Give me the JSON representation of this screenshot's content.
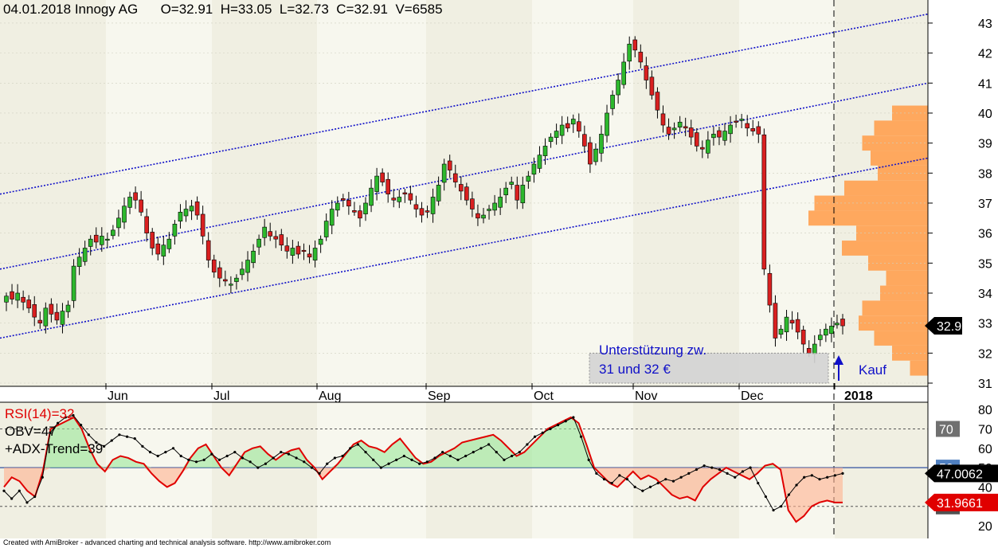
{
  "header": {
    "date": "04.01.2018",
    "name": "Innogy AG",
    "ohlcv": "O=32.91  H=33.05  L=32.73  C=32.91  V=6585"
  },
  "footer": "Created with AmiBroker - advanced charting and technical analysis software. http://www.amibroker.com",
  "colors": {
    "up": "#2db82d",
    "down": "#d92020",
    "channel": "#1010c8",
    "volume_profile": "#ffa050",
    "rsi": "#e00000",
    "obv": "#000000",
    "ref_line": "#3050a0"
  },
  "chart_data": [
    {
      "type": "candlestick",
      "title": "04.01.2018 Innogy AG",
      "ylim": [
        31,
        43
      ],
      "y_ticks": [
        31,
        32,
        33,
        34,
        35,
        36,
        37,
        38,
        39,
        40,
        41,
        42,
        43
      ],
      "x_labels": [
        "Jun",
        "Jul",
        "Aug",
        "Sep",
        "Oct",
        "Nov",
        "Dec",
        "2018"
      ],
      "last_price_label": "32.91",
      "annotations": [
        {
          "text": "Unterstützung zw.",
          "text2": "31 und 32 €"
        },
        {
          "text": "Kauf"
        }
      ],
      "close_path": [
        33.9,
        33.8,
        34.0,
        33.7,
        33.5,
        33.2,
        33.0,
        33.5,
        33.3,
        33.1,
        33.4,
        33.6,
        34.9,
        35.2,
        35.5,
        35.8,
        35.7,
        35.9,
        35.8,
        36.1,
        36.5,
        36.9,
        37.2,
        37.1,
        36.7,
        36.0,
        35.5,
        35.3,
        35.6,
        35.8,
        36.3,
        36.7,
        36.8,
        36.9,
        36.6,
        35.9,
        35.1,
        34.7,
        34.5,
        34.4,
        34.3,
        34.5,
        34.8,
        35.1,
        35.4,
        35.8,
        36.2,
        35.9,
        35.8,
        35.6,
        35.4,
        35.5,
        35.3,
        35.4,
        35.2,
        35.5,
        35.8,
        36.4,
        36.8,
        37.0,
        37.1,
        36.9,
        36.7,
        36.5,
        37.0,
        37.5,
        37.9,
        37.7,
        37.3,
        37.1,
        37.2,
        37.3,
        37.1,
        36.8,
        36.6,
        36.7,
        37.2,
        37.6,
        38.3,
        38.1,
        37.7,
        37.4,
        37.1,
        36.8,
        36.5,
        36.6,
        36.8,
        37.0,
        37.2,
        37.5,
        37.7,
        37.1,
        37.6,
        37.9,
        38.3,
        38.6,
        38.9,
        39.2,
        39.4,
        39.6,
        39.5,
        39.8,
        39.4,
        38.9,
        38.3,
        38.8,
        39.3,
        40.0,
        40.6,
        41.1,
        41.7,
        42.3,
        42.1,
        41.7,
        41.1,
        40.6,
        40.1,
        39.6,
        39.3,
        39.5,
        39.7,
        39.5,
        39.2,
        38.9,
        38.8,
        39.1,
        39.3,
        39.2,
        39.4,
        39.6,
        39.7,
        39.8,
        39.5,
        39.4,
        39.3,
        34.8,
        33.6,
        32.5,
        32.8,
        33.2,
        33.0,
        32.7,
        32.3,
        32.0,
        32.3,
        32.6,
        32.8,
        32.9,
        33.0,
        32.91
      ],
      "channel_lines": [
        {
          "start": [
            0,
            37.3
          ],
          "end": [
            1,
            43.3
          ]
        },
        {
          "start": [
            0,
            34.8
          ],
          "end": [
            1,
            41.0
          ]
        },
        {
          "start": [
            0,
            32.5
          ],
          "end": [
            1,
            38.5
          ]
        }
      ],
      "volume_profile": [
        {
          "price": 40.0,
          "v": 0.3
        },
        {
          "price": 39.5,
          "v": 0.45
        },
        {
          "price": 39.0,
          "v": 0.55
        },
        {
          "price": 38.5,
          "v": 0.48
        },
        {
          "price": 38.0,
          "v": 0.42
        },
        {
          "price": 37.5,
          "v": 0.7
        },
        {
          "price": 37.0,
          "v": 0.95
        },
        {
          "price": 36.5,
          "v": 1.0
        },
        {
          "price": 36.0,
          "v": 0.6
        },
        {
          "price": 35.5,
          "v": 0.72
        },
        {
          "price": 35.0,
          "v": 0.5
        },
        {
          "price": 34.5,
          "v": 0.35
        },
        {
          "price": 34.0,
          "v": 0.4
        },
        {
          "price": 33.5,
          "v": 0.55
        },
        {
          "price": 33.0,
          "v": 0.58
        },
        {
          "price": 32.5,
          "v": 0.45
        },
        {
          "price": 32.0,
          "v": 0.3
        },
        {
          "price": 31.5,
          "v": 0.15
        }
      ]
    },
    {
      "type": "line",
      "title": "RSI(14)=32",
      "labels": [
        "RSI(14)=32",
        "OBV=47",
        "+ADX-Trend=39"
      ],
      "ylim": [
        15,
        80
      ],
      "y_ticks": [
        20,
        30,
        40,
        50,
        60,
        70,
        80
      ],
      "levels": [
        "70",
        "50",
        "30"
      ],
      "value_labels": [
        "47.0062",
        "31.9661"
      ],
      "series": [
        {
          "name": "RSI(14)",
          "values": [
            40,
            45,
            43,
            38,
            35,
            48,
            70,
            72,
            74,
            76,
            70,
            60,
            52,
            48,
            54,
            56,
            55,
            53,
            52,
            47,
            43,
            40,
            42,
            48,
            55,
            60,
            62,
            56,
            50,
            46,
            52,
            58,
            60,
            61,
            57,
            54,
            57,
            59,
            60,
            54,
            50,
            44,
            48,
            52,
            57,
            62,
            64,
            61,
            60,
            58,
            62,
            65,
            60,
            55,
            52,
            53,
            56,
            58,
            60,
            63,
            64,
            65,
            66,
            67,
            64,
            60,
            56,
            58,
            62,
            66,
            70,
            72,
            74,
            76,
            73,
            62,
            50,
            46,
            42,
            40,
            44,
            48,
            44,
            46,
            44,
            40,
            36,
            34,
            35,
            33,
            40,
            44,
            47,
            50,
            48,
            46,
            44,
            47,
            51,
            52,
            49,
            28,
            22,
            25,
            30,
            32,
            33,
            32,
            31.97
          ]
        },
        {
          "name": "OBV",
          "values": [
            38,
            34,
            38,
            32,
            35,
            45,
            68,
            73,
            76,
            77,
            72,
            67,
            63,
            61,
            64,
            67,
            66,
            65,
            61,
            58,
            56,
            58,
            60,
            56,
            54,
            53,
            54,
            57,
            54,
            56,
            58,
            55,
            53,
            50,
            52,
            55,
            58,
            57,
            55,
            53,
            50,
            47,
            52,
            55,
            56,
            60,
            62,
            58,
            54,
            50,
            52,
            54,
            56,
            54,
            52,
            53,
            55,
            58,
            56,
            54,
            56,
            58,
            60,
            62,
            58,
            54,
            56,
            58,
            62,
            66,
            68,
            70,
            72,
            74,
            76,
            66,
            54,
            47,
            44,
            42,
            46,
            44,
            40,
            38,
            40,
            42,
            44,
            43,
            45,
            47,
            49,
            51,
            50,
            49,
            47,
            45,
            48,
            50,
            42,
            35,
            28,
            30,
            36,
            41,
            45,
            46,
            44,
            45,
            46,
            47.01
          ]
        }
      ]
    }
  ]
}
